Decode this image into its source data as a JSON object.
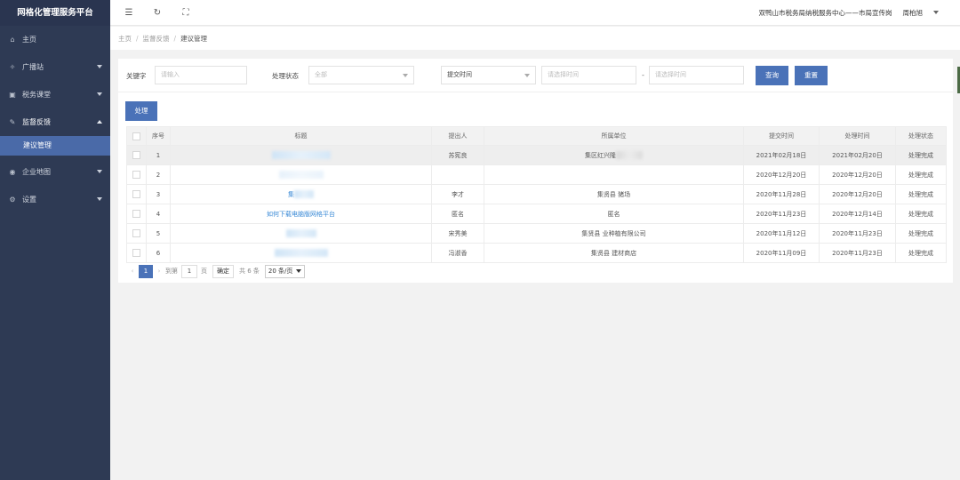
{
  "brand": "网格化管理服务平台",
  "sidebar": {
    "items": [
      {
        "label": "主页",
        "icon": "home-icon",
        "expandable": false
      },
      {
        "label": "广播站",
        "icon": "broadcast-icon",
        "expandable": true
      },
      {
        "label": "税务课堂",
        "icon": "video-icon",
        "expandable": true
      },
      {
        "label": "监督反馈",
        "icon": "edit-icon",
        "expandable": true,
        "open": true
      },
      {
        "label": "企业地图",
        "icon": "location-icon",
        "expandable": true
      },
      {
        "label": "设置",
        "icon": "gear-icon",
        "expandable": true
      }
    ],
    "sub_item": "建议管理"
  },
  "topbar": {
    "org": "双鸭山市税务局纳税服务中心——市局宣传岗",
    "user": "周柏旭"
  },
  "breadcrumb": [
    "主页",
    "监督反馈",
    "建议管理"
  ],
  "filter": {
    "keyword_label": "关键字",
    "keyword_placeholder": "请输入",
    "status_label": "处理状态",
    "status_value": "全部",
    "time_field": "提交时间",
    "start_placeholder": "请选择时间",
    "dash": "-",
    "end_placeholder": "请选择时间",
    "query_label": "查询",
    "reset_label": "重置"
  },
  "process_button": "处理",
  "table": {
    "headers": [
      "序号",
      "标题",
      "提出人",
      "所属单位",
      "提交时间",
      "处理时间",
      "处理状态"
    ],
    "rows": [
      {
        "no": "1",
        "title": "",
        "proposer": "苏宪良",
        "unit": "集区红兴隆",
        "submit": "2021年02月18日",
        "handled": "2021年02月20日",
        "status": "处理完成"
      },
      {
        "no": "2",
        "title": "",
        "proposer": "",
        "unit": "",
        "submit": "2020年12月20日",
        "handled": "2020年12月20日",
        "status": "处理完成"
      },
      {
        "no": "3",
        "title": "集",
        "proposer": "李才",
        "unit": "集贤县  猪场",
        "submit": "2020年11月28日",
        "handled": "2020年12月20日",
        "status": "处理完成"
      },
      {
        "no": "4",
        "title": "如何下载电脑版网格平台",
        "proposer": "匿名",
        "unit": "匿名",
        "submit": "2020年11月23日",
        "handled": "2020年12月14日",
        "status": "处理完成"
      },
      {
        "no": "5",
        "title": "",
        "proposer": "宋秀美",
        "unit": "集贤县  业种植有限公司",
        "submit": "2020年11月12日",
        "handled": "2020年11月23日",
        "status": "处理完成"
      },
      {
        "no": "6",
        "title": "",
        "proposer": "冯淑香",
        "unit": "集贤县  建材商店",
        "submit": "2020年11月09日",
        "handled": "2020年11月23日",
        "status": "处理完成"
      }
    ]
  },
  "pager": {
    "prev": "‹",
    "current": "1",
    "next": "›",
    "goto_label": "到第",
    "goto_value": "1",
    "page_unit": "页",
    "confirm": "确定",
    "total": "共 6 条",
    "page_size": "20 条/页"
  },
  "colors": {
    "sidebar_bg": "#2e3a54",
    "primary": "#4a72b8",
    "link": "#3a8ad6"
  }
}
